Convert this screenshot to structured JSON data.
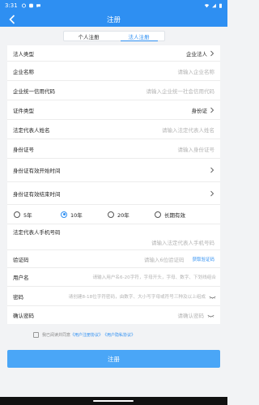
{
  "status": {
    "time": "3:31",
    "battery_icon": "battery-icon",
    "signal_icon": "signal-icon"
  },
  "header": {
    "title": "注册",
    "back_icon": "back-arrow-icon",
    "color": "#2e8ff2"
  },
  "tabs": [
    {
      "label": "个人注册",
      "active": false
    },
    {
      "label": "法人注册",
      "active": true
    }
  ],
  "form": {
    "legal_type": {
      "label": "法人类型",
      "value": "企业法人"
    },
    "company_name": {
      "label": "企业名称",
      "placeholder": "请输入企业名称"
    },
    "credit_code": {
      "label": "企业统一信用代码",
      "placeholder": "请输入企业统一社会信用代码"
    },
    "id_type": {
      "label": "证件类型",
      "value": "身份证"
    },
    "rep_name": {
      "label": "法定代表人姓名",
      "placeholder": "请输入法定代表人姓名"
    },
    "id_number": {
      "label": "身份证号",
      "placeholder": "请输入身份证号"
    },
    "id_start": {
      "label": "身份证有效开始时间"
    },
    "id_end": {
      "label": "身份证有效结束时间"
    },
    "validity": {
      "options": [
        {
          "label": "5年",
          "checked": false
        },
        {
          "label": "10年",
          "checked": true
        },
        {
          "label": "20年",
          "checked": false
        },
        {
          "label": "长期有效",
          "checked": false
        }
      ]
    },
    "rep_phone": {
      "label": "法定代表人手机号码",
      "placeholder": "请输入法定代表人手机号码"
    },
    "verify_code": {
      "label": "验证码",
      "placeholder": "请输入6位验证码",
      "button": "获取验证码"
    },
    "username": {
      "label": "用户名",
      "placeholder": "请输入用户名6-20字符，字母开头，字母、数字、下划线组合"
    },
    "password": {
      "label": "密码",
      "placeholder": "请创建8-18位字符密码，由数字、大小写字母或符号三种及以上组成"
    },
    "confirm_password": {
      "label": "确认密码",
      "placeholder": "请确认密码"
    }
  },
  "agreement": {
    "text": "我已阅读并同意",
    "link1": "《用户注册协议》",
    "link2": "《用户隐私协议》"
  },
  "submit_label": "注册"
}
